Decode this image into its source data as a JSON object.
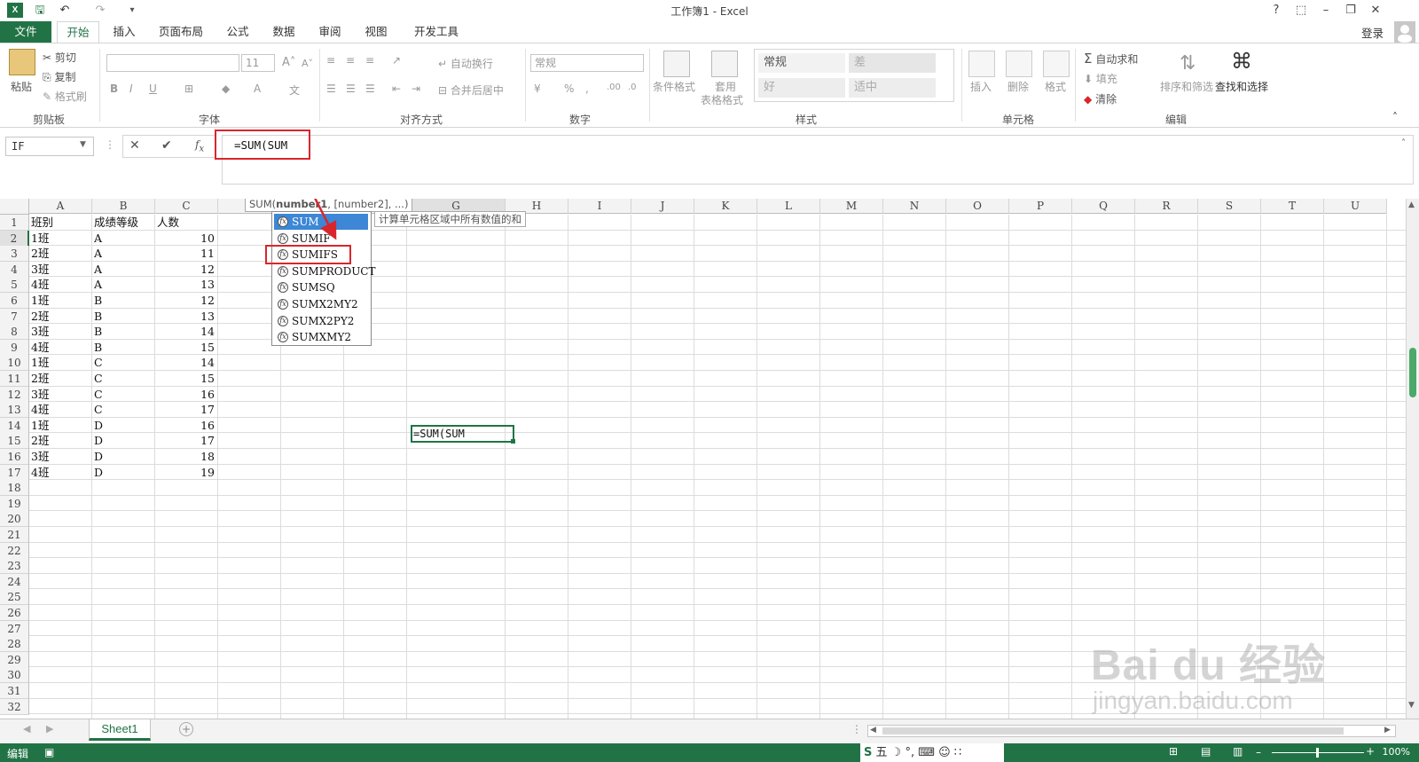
{
  "window": {
    "title": "工作簿1 - Excel",
    "login": "登录"
  },
  "tabs": [
    "文件",
    "开始",
    "插入",
    "页面布局",
    "公式",
    "数据",
    "审阅",
    "视图",
    "开发工具"
  ],
  "ribbon": {
    "clipboard": {
      "paste": "粘贴",
      "cut": "剪切",
      "copy": "复制",
      "format_painter": "格式刷",
      "group": "剪贴板"
    },
    "font": {
      "size": "11",
      "group": "字体"
    },
    "alignment": {
      "wrap": "自动换行",
      "merge": "合并后居中",
      "group": "对齐方式"
    },
    "number": {
      "format": "常规",
      "group": "数字"
    },
    "styles": {
      "conditional": "条件格式",
      "table_line1": "套用",
      "table_line2": "表格格式",
      "normal": "常规",
      "bad": "差",
      "good": "好",
      "neutral": "适中",
      "group": "样式"
    },
    "cells": {
      "insert": "插入",
      "delete": "删除",
      "format": "格式",
      "group": "单元格"
    },
    "editing": {
      "autosum": "自动求和",
      "fill": "填充",
      "clear": "清除",
      "sort": "排序和筛选",
      "find": "查找和选择",
      "group": "编辑"
    }
  },
  "formula_bar": {
    "name_box": "IF",
    "formula": "=SUM(SUM"
  },
  "columns": [
    "A",
    "B",
    "C",
    "D",
    "E",
    "F",
    "G",
    "H",
    "I",
    "J",
    "K",
    "L",
    "M",
    "N",
    "O",
    "P",
    "Q",
    "R",
    "S",
    "T",
    "U"
  ],
  "rows": [
    [
      "班别",
      "成绩等级",
      "人数"
    ],
    [
      "1班",
      "A",
      "10"
    ],
    [
      "2班",
      "A",
      "11"
    ],
    [
      "3班",
      "A",
      "12"
    ],
    [
      "4班",
      "A",
      "13"
    ],
    [
      "1班",
      "B",
      "12"
    ],
    [
      "2班",
      "B",
      "13"
    ],
    [
      "3班",
      "B",
      "14"
    ],
    [
      "4班",
      "B",
      "15"
    ],
    [
      "1班",
      "C",
      "14"
    ],
    [
      "2班",
      "C",
      "15"
    ],
    [
      "3班",
      "C",
      "16"
    ],
    [
      "4班",
      "C",
      "17"
    ],
    [
      "1班",
      "D",
      "16"
    ],
    [
      "2班",
      "D",
      "17"
    ],
    [
      "3班",
      "D",
      "18"
    ],
    [
      "4班",
      "D",
      "19"
    ]
  ],
  "row_count": 32,
  "active_cell_value": "=SUM(SUM",
  "function_tooltip": {
    "prefix": "SUM(",
    "bold": "number1",
    "rest": ", [number2], ...)"
  },
  "function_description": "计算单元格区域中所有数值的和",
  "autocomplete": [
    "SUM",
    "SUMIF",
    "SUMIFS",
    "SUMPRODUCT",
    "SUMSQ",
    "SUMX2MY2",
    "SUMX2PY2",
    "SUMXMY2"
  ],
  "sheet_tab": "Sheet1",
  "status": {
    "mode": "编辑",
    "zoom": "100%",
    "ime": "五"
  },
  "watermark": {
    "main": "Bai du 经验",
    "sub": "jingyan.baidu.com"
  },
  "colors": {
    "excel_green": "#217346",
    "highlight_red": "#d9262c",
    "selection_blue": "#3d87d6"
  }
}
